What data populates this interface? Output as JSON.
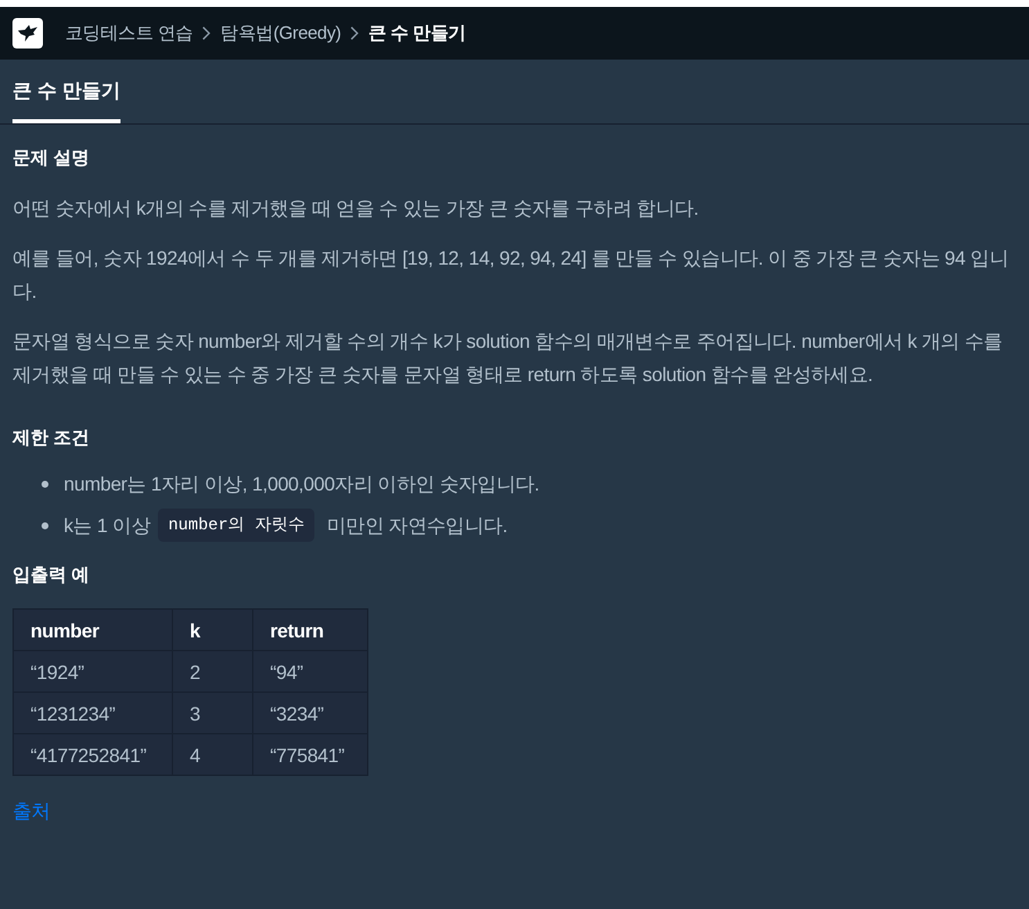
{
  "header": {
    "breadcrumb": [
      {
        "label": "코딩테스트 연습",
        "current": false
      },
      {
        "label": "탐욕법(Greedy)",
        "current": false
      },
      {
        "label": "큰 수 만들기",
        "current": true
      }
    ]
  },
  "tabs": [
    {
      "label": "큰 수 만들기",
      "selected": true
    }
  ],
  "description": {
    "heading": "문제 설명",
    "paragraphs": [
      "어떤 숫자에서 k개의 수를 제거했을 때 얻을 수 있는 가장 큰 숫자를 구하려 합니다.",
      "예를 들어, 숫자 1924에서 수 두 개를 제거하면 [19, 12, 14, 92, 94, 24] 를 만들 수 있습니다. 이 중 가장 큰 숫자는 94 입니다.",
      "문자열 형식으로 숫자 number와 제거할 수의 개수 k가 solution 함수의 매개변수로 주어집니다. number에서 k 개의 수를 제거했을 때 만들 수 있는 수 중 가장 큰 숫자를 문자열 형태로 return 하도록 solution 함수를 완성하세요."
    ]
  },
  "constraints": {
    "heading": "제한 조건",
    "items": [
      {
        "segments": [
          {
            "kind": "text",
            "text": "number는 1자리 이상, 1,000,000자리 이하인 숫자입니다."
          }
        ]
      },
      {
        "segments": [
          {
            "kind": "text",
            "text": "k는 1 이상"
          },
          {
            "kind": "code",
            "text": "number의 자릿수"
          },
          {
            "kind": "text",
            "text": "미만인 자연수입니다."
          }
        ]
      }
    ]
  },
  "examples": {
    "heading": "입출력 예",
    "table": {
      "columns": [
        "number",
        "k",
        "return"
      ],
      "rows": [
        [
          "“1924”",
          "2",
          "“94”"
        ],
        [
          "“1231234”",
          "3",
          "“3234”"
        ],
        [
          "“4177252841”",
          "4",
          "“775841”"
        ]
      ]
    }
  },
  "source_link": "출처"
}
